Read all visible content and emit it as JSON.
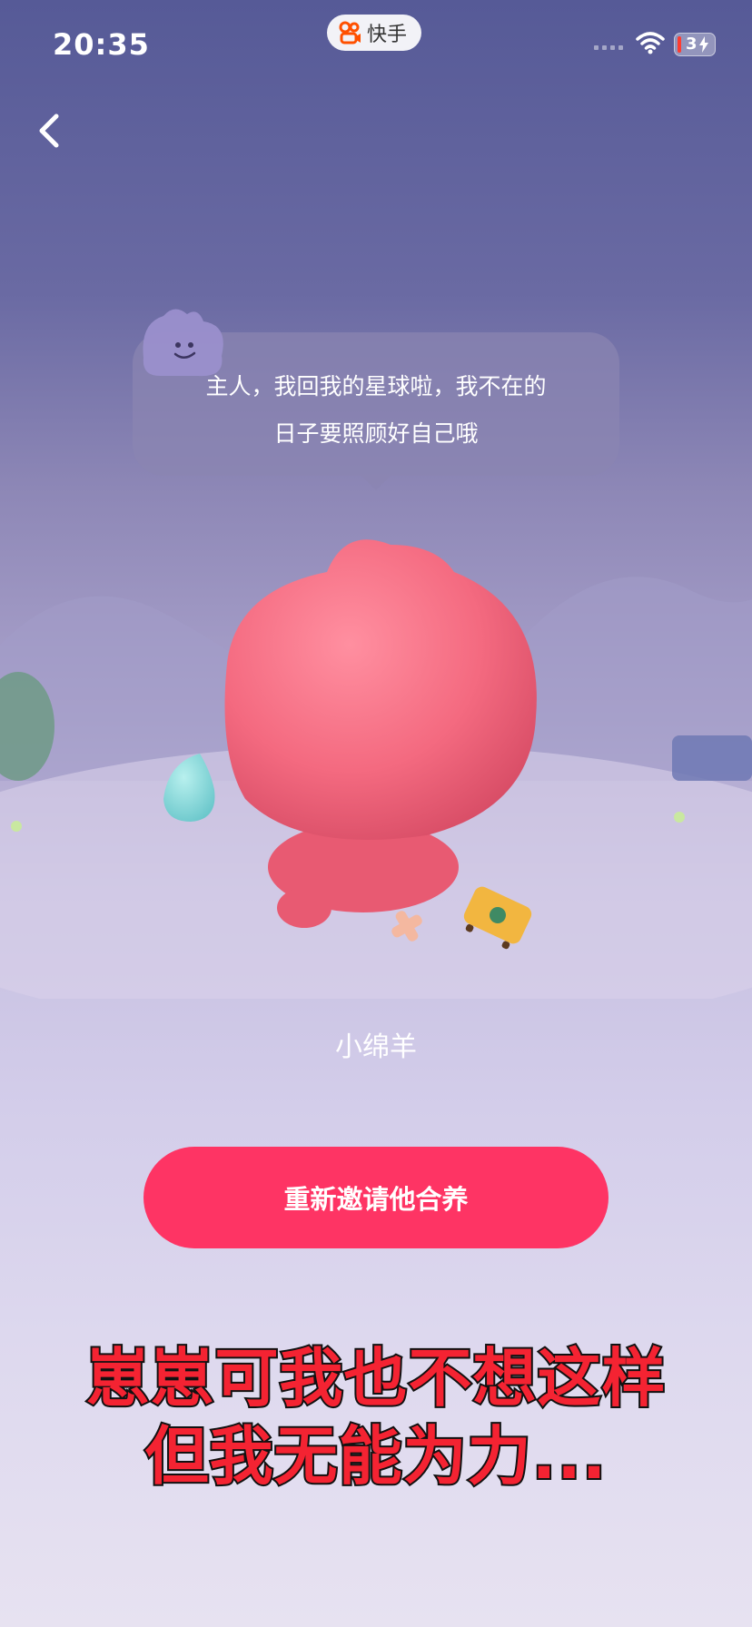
{
  "status_bar": {
    "time": "20:35",
    "app_name": "快手",
    "battery_level": "3"
  },
  "bubble": {
    "line1": "主人，我回我的星球啦，我不在的",
    "line2": "日子要照顾好自己哦"
  },
  "pet": {
    "name": "小绵羊"
  },
  "actions": {
    "reinvite_label": "重新邀请他合养"
  },
  "caption": {
    "line1": "崽崽可我也不想这样",
    "line2": "但我无能为力..."
  },
  "colors": {
    "button": "#fe3464",
    "caption_text": "#f42332",
    "pet_body": "#f46a80"
  }
}
